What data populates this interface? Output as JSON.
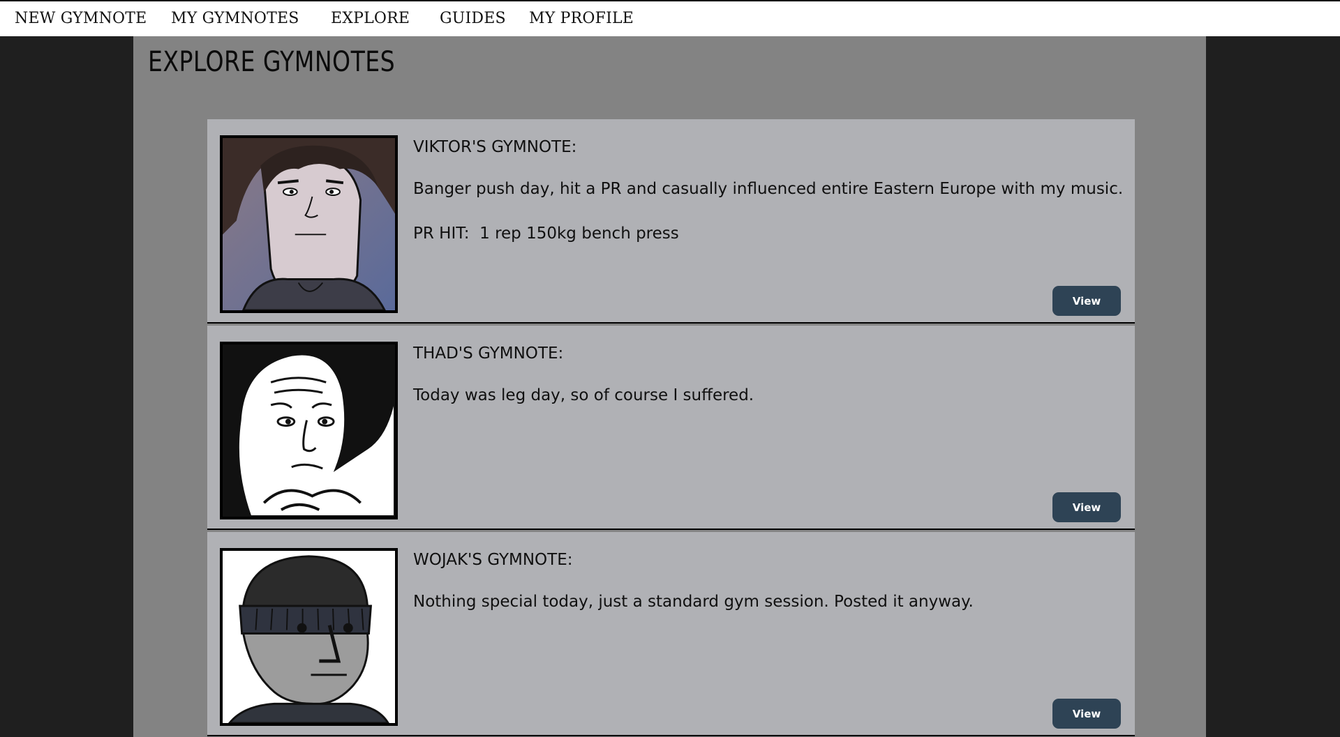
{
  "nav": {
    "items": [
      {
        "label": "NEW GYMNOTE"
      },
      {
        "label": "MY GYMNOTES"
      },
      {
        "label": "EXPLORE"
      },
      {
        "label": "GUIDES"
      },
      {
        "label": "MY PROFILE"
      }
    ]
  },
  "page": {
    "title": "EXPLORE GYMNOTES"
  },
  "posts": [
    {
      "title": "VIKTOR'S GYMNOTE:",
      "body": "Banger push day, hit a PR and casually influenced entire Eastern Europe with my music.",
      "extra": "PR HIT:  1 rep 150kg bench press",
      "avatar_icon": "viktor-avatar-illustration",
      "view_label": "View"
    },
    {
      "title": "THAD'S GYMNOTE:",
      "body": "Today was leg day, so of course I suffered.",
      "extra": "",
      "avatar_icon": "thad-avatar-illustration",
      "view_label": "View"
    },
    {
      "title": "WOJAK'S GYMNOTE:",
      "body": "Nothing special today, just a standard gym session. Posted it anyway.",
      "extra": "",
      "avatar_icon": "wojak-avatar-illustration",
      "view_label": "View"
    }
  ],
  "colors": {
    "button_bg": "#2e4355",
    "card_bg": "#b0b1b5",
    "page_bg": "#838383",
    "outer_bg": "#1f1f1f"
  }
}
